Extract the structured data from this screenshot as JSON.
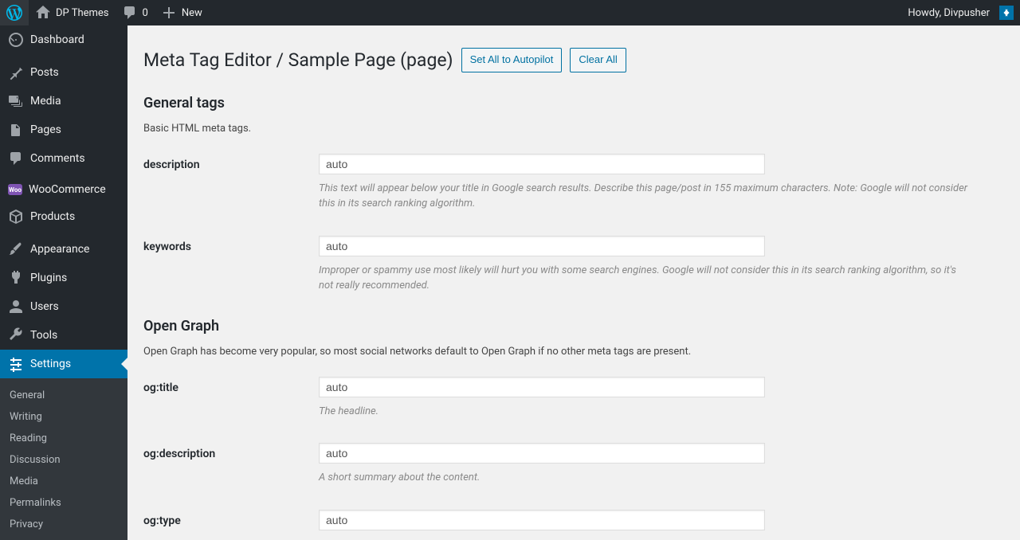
{
  "adminbar": {
    "site_name": "DP Themes",
    "comment_count": "0",
    "new_label": "New",
    "howdy": "Howdy, Divpusher"
  },
  "sidebar": {
    "items": [
      {
        "label": "Dashboard",
        "icon": "dashboard"
      },
      {
        "label": "Posts",
        "icon": "pin"
      },
      {
        "label": "Media",
        "icon": "media"
      },
      {
        "label": "Pages",
        "icon": "pages"
      },
      {
        "label": "Comments",
        "icon": "comment"
      },
      {
        "label": "WooCommerce",
        "icon": "woo"
      },
      {
        "label": "Products",
        "icon": "product"
      },
      {
        "label": "Appearance",
        "icon": "brush"
      },
      {
        "label": "Plugins",
        "icon": "plug"
      },
      {
        "label": "Users",
        "icon": "users"
      },
      {
        "label": "Tools",
        "icon": "wrench"
      },
      {
        "label": "Settings",
        "icon": "sliders"
      }
    ],
    "submenu": [
      "General",
      "Writing",
      "Reading",
      "Discussion",
      "Media",
      "Permalinks",
      "Privacy"
    ]
  },
  "page": {
    "title": "Meta Tag Editor / Sample Page (page)",
    "autopilot_btn": "Set All to Autopilot",
    "clear_btn": "Clear All"
  },
  "sections": [
    {
      "title": "General tags",
      "desc": "Basic HTML meta tags.",
      "fields": [
        {
          "label": "description",
          "value": "auto",
          "help": "This text will appear below your title in Google search results. Describe this page/post in 155 maximum characters. Note: Google will not consider this in its search ranking algorithm."
        },
        {
          "label": "keywords",
          "value": "auto",
          "help": "Improper or spammy use most likely will hurt you with some search engines. Google will not consider this in its search ranking algorithm, so it's not really recommended."
        }
      ]
    },
    {
      "title": "Open Graph",
      "desc": "Open Graph has become very popular, so most social networks default to Open Graph if no other meta tags are present.",
      "fields": [
        {
          "label": "og:title",
          "value": "auto",
          "help": "The headline."
        },
        {
          "label": "og:description",
          "value": "auto",
          "help": "A short summary about the content."
        },
        {
          "label": "og:type",
          "value": "auto",
          "help": ""
        }
      ]
    }
  ]
}
